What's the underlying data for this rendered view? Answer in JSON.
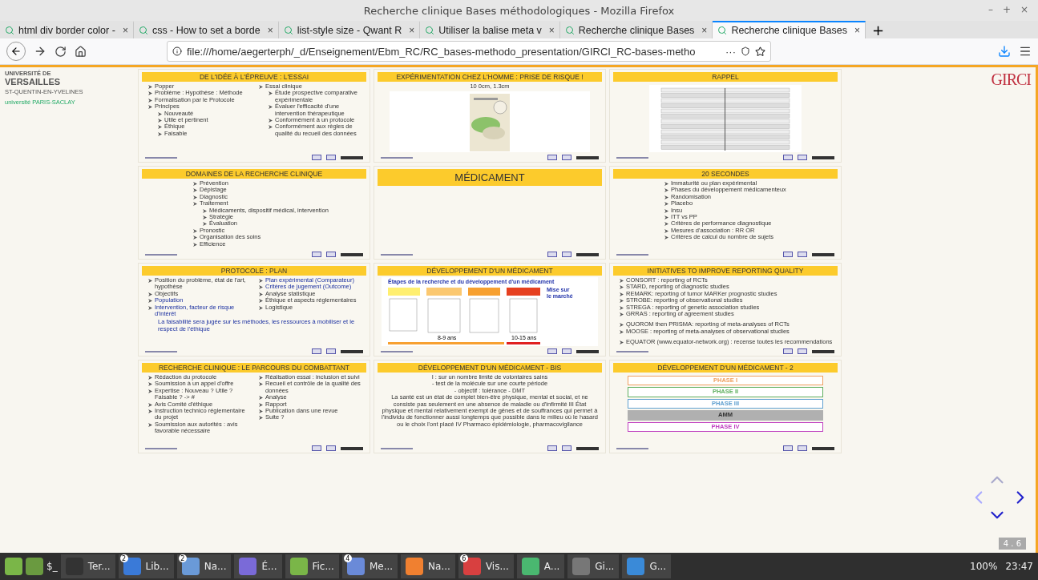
{
  "window": {
    "title": "Recherche clinique Bases méthodologiques - Mozilla Firefox",
    "controls": [
      "–",
      "+",
      "×"
    ]
  },
  "tabs": [
    {
      "label": "html div border color - ",
      "close": "×",
      "selected": false
    },
    {
      "label": "css - How to set a borde",
      "close": "×",
      "selected": false
    },
    {
      "label": "list-style size - Qwant R",
      "close": "×",
      "selected": false
    },
    {
      "label": "Utiliser la balise meta v",
      "close": "×",
      "selected": false
    },
    {
      "label": "Recherche clinique Bases",
      "close": "×",
      "selected": false
    },
    {
      "label": "Recherche clinique Bases",
      "close": "×",
      "selected": true
    }
  ],
  "new_tab": "+",
  "url": "file:///home/aegerterph/_d/Enseignement/Ebm_RC/RC_bases-methodo_presentation/GIRCI_RC-bases-metho",
  "url_more": "···",
  "left_logo": {
    "line1": "UNIVERSITÉ DE",
    "line2": "VERSAILLES",
    "line3": "ST-QUENTIN-EN-YVELINES",
    "line4": "université PARIS-SACLAY"
  },
  "right_logo": "GIRCI",
  "slides": [
    {
      "kind": "list",
      "title": "DE L'IDÉE À L'ÉPREUVE : L'ESSAI",
      "items": [
        {
          "text": "Popper"
        },
        {
          "text": "Problème : Hypothèse : Méthode"
        },
        {
          "text": "Formalisation par le Protocole"
        },
        {
          "text": "Principes",
          "children": [
            {
              "text": "Nouveauté"
            },
            {
              "text": "Utile et pertinent"
            },
            {
              "text": "Éthique"
            },
            {
              "text": "Faisable"
            }
          ]
        },
        {
          "text": "Essai clinique",
          "children": [
            {
              "text": "Étude prospective comparative expérimentale"
            },
            {
              "text": "Évaluer l'efficacité d'une intervention thérapeutique"
            },
            {
              "text": "Conformément à un protocole"
            },
            {
              "text": "Conformément aux règles de qualité du recueil des données"
            }
          ]
        }
      ]
    },
    {
      "title": "EXPÉRIMENTATION CHEZ L'HOMME : PRISE DE RISQUE !",
      "caption": "10 0cm, 1.3cm"
    },
    {
      "kind": "table",
      "title": "RAPPEL"
    },
    {
      "kind": "list",
      "title": "DOMAINES DE LA RECHERCHE CLINIQUE",
      "items": [
        {
          "text": "Prévention"
        },
        {
          "text": "Dépistage"
        },
        {
          "text": "Diagnostic"
        },
        {
          "text": "Traitement",
          "children": [
            {
              "text": "Médicaments, dispositif médical, intervention"
            },
            {
              "text": "Stratégie"
            },
            {
              "text": "Évaluation"
            }
          ]
        },
        {
          "text": "Pronostic"
        },
        {
          "text": "Organisation des soins"
        },
        {
          "text": "Efficience"
        }
      ]
    },
    {
      "kind": "section",
      "title": "MÉDICAMENT"
    },
    {
      "kind": "list",
      "title": "20 SECONDES",
      "items": [
        {
          "text": "Immaturité ou plan expérimental"
        },
        {
          "text": "Phases du développement médicamenteux"
        },
        {
          "text": "Randomisation"
        },
        {
          "text": "Placebo"
        },
        {
          "text": "Insu"
        },
        {
          "text": "ITT vs PP"
        },
        {
          "text": "Critères de performance diagnostique"
        },
        {
          "text": "Mesures d'association : RR OR"
        },
        {
          "text": "Critères de calcul du nombre de sujets"
        }
      ]
    },
    {
      "kind": "list",
      "title": "PROTOCOLE : PLAN",
      "items": [
        {
          "text": "Position du problème, état de l'art, hypothèse",
          "highlight": false
        },
        {
          "text": "Objectifs",
          "highlight": false
        },
        {
          "text": "Population",
          "highlight": true
        },
        {
          "text": "Intervention, facteur de risque d'intérêt",
          "highlight": true
        },
        {
          "text": "Plan expérimental (Comparateur)",
          "highlight": true
        },
        {
          "text": "Critères de jugement (Outcome)",
          "highlight": true
        },
        {
          "text": "Analyse statistique",
          "highlight": false
        },
        {
          "text": "Éthique et aspects réglementaires",
          "highlight": false
        },
        {
          "text": "Logistique",
          "highlight": false
        }
      ],
      "note": "La faisabilité sera jugée sur les méthodes, les ressources à mobiliser et le respect de l'éthique"
    },
    {
      "kind": "diagram",
      "title": "DÉVELOPPEMENT D'UN MÉDICAMENT",
      "heading": "Étapes de la recherche et du développement d'un médicament",
      "market": [
        "Mise sur",
        "le marché"
      ],
      "spans": [
        "8-9 ans",
        "10-15 ans"
      ]
    },
    {
      "kind": "list",
      "title": "INITIATIVES TO IMPROVE REPORTING QUALITY",
      "items": [
        {
          "text": "CONSORT : reporting of RCTs"
        },
        {
          "text": "STARD, reporting of diagnostic studies"
        },
        {
          "text": "REMARK: reporting of tumor MARKer prognostic studies"
        },
        {
          "text": "STROBE: reporting of observational studies"
        },
        {
          "text": "STREGA : reporting of genetic association studies"
        },
        {
          "text": "GRRAS : reporting of agreement studies"
        },
        {
          "text": "QUOROM then PRISMA: reporting of meta-analyses of RCTs",
          "gap": true
        },
        {
          "text": "MOOSE : reporting of meta-analyses of observational studies"
        },
        {
          "text": "EQUATOR (www.equator-network.org) : recense toutes les recommendations",
          "gap": true
        }
      ]
    },
    {
      "kind": "list",
      "title": "RECHERCHE CLINIQUE : LE PARCOURS DU COMBATTANT",
      "items": [
        {
          "text": "Rédaction du protocole"
        },
        {
          "text": "Soumission à un appel d'offre"
        },
        {
          "text": "Expertise : Nouveau ? Utile ? Faisable ?  -> #"
        },
        {
          "text": "Avis Comité d'éthique"
        },
        {
          "text": "Instruction technico réglementaire du projet"
        },
        {
          "text": "Soumission aux autorités : avis favorable nécessaire"
        },
        {
          "text": "Réalisation essai : inclusion et suivi"
        },
        {
          "text": "Recueil et contrôle de la qualité des données"
        },
        {
          "text": "Analyse"
        },
        {
          "text": "Rapport"
        },
        {
          "text": "Publication dans une revue"
        },
        {
          "text": "Suite ?"
        }
      ]
    },
    {
      "kind": "text",
      "title": "DÉVELOPPEMENT D'UN MÉDICAMENT - BIS",
      "lines": [
        "I : sur un nombre limité de volontaires sains",
        "- test de la molécule sur une courte période",
        "- objectif : tolérance - DMT",
        "La santé est un état de complet bien-être physique, mental et social, et ne consiste pas seulement en une absence de maladie ou d'infirmité III État physique et mental relativement exempt de gênes et de souffrances qui permet à l'individu de fonctionner aussi longtemps que possible dans le milieu où le hasard ou le choix l'ont placé IV Pharmaco épidémiologie, pharmacovigilance"
      ]
    },
    {
      "kind": "phases",
      "title": "DÉVELOPPEMENT D'UN MÉDICAMENT - 2",
      "phases": [
        {
          "label": "PHASE I",
          "color": "#f0a060"
        },
        {
          "label": "PHASE II",
          "color": "#60b060"
        },
        {
          "label": "PHASE III",
          "color": "#60a0d0"
        },
        {
          "label": "AMM",
          "color": "#b0b0b0"
        },
        {
          "label": "PHASE IV",
          "color": "#c040c0"
        }
      ]
    }
  ],
  "slide_number": "4 . 6",
  "taskbar": [
    {
      "label": "Ter..."
    },
    {
      "label": "Lib...",
      "badge": "2"
    },
    {
      "label": "Na...",
      "badge": "2"
    },
    {
      "label": "É..."
    },
    {
      "label": "Fic..."
    },
    {
      "label": "Me...",
      "badge": "4"
    },
    {
      "label": "Na..."
    },
    {
      "label": "Vis...",
      "badge": "6"
    },
    {
      "label": "A..."
    },
    {
      "label": "Gi..."
    },
    {
      "label": "G..."
    }
  ],
  "terminal_glyph": "$_",
  "battery": "100%",
  "clock": "23:47"
}
